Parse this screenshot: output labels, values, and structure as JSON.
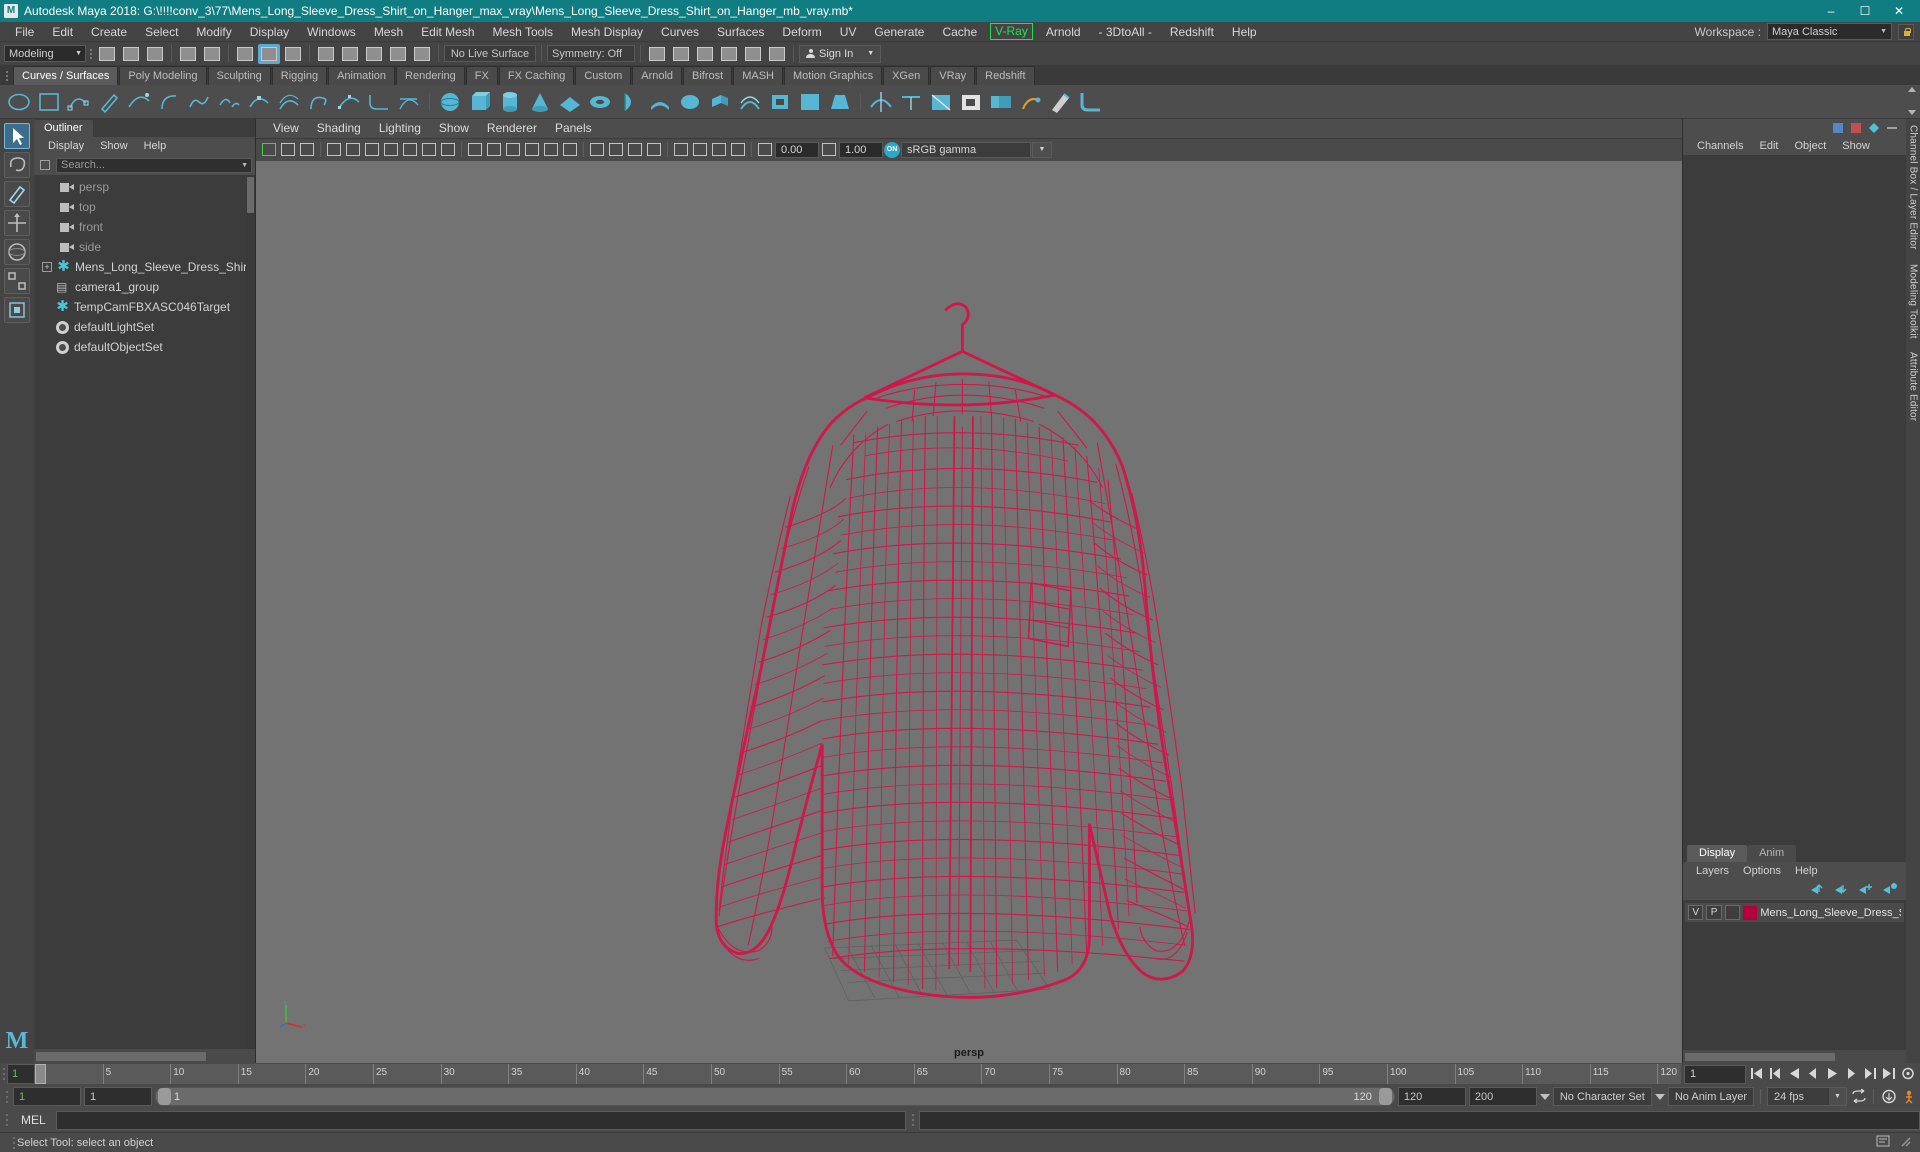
{
  "window": {
    "title": "Autodesk Maya 2018: G:\\!!!!conv_3\\77\\Mens_Long_Sleeve_Dress_Shirt_on_Hanger_max_vray\\Mens_Long_Sleeve_Dress_Shirt_on_Hanger_mb_vray.mb*",
    "app_icon": "M",
    "minimize": "–",
    "maximize": "☐",
    "close": "✕"
  },
  "menubar": {
    "items": [
      "File",
      "Edit",
      "Create",
      "Select",
      "Modify",
      "Display",
      "Windows",
      "Mesh",
      "Edit Mesh",
      "Mesh Tools",
      "Mesh Display",
      "Curves",
      "Surfaces",
      "Deform",
      "UV",
      "Generate",
      "Cache",
      "V-Ray",
      "Arnold",
      "- 3DtoAll -",
      "Redshift",
      "Help"
    ],
    "highlight_item": "V-Ray",
    "highlight_color": "#22e04a",
    "workspace_label": "Workspace :",
    "workspace_value": "Maya Classic"
  },
  "statusline": {
    "mode": "Modeling",
    "live_surface": "No Live Surface",
    "symmetry": "Symmetry: Off",
    "signin": "Sign In"
  },
  "shelf": {
    "tabs": [
      "Curves / Surfaces",
      "Poly Modeling",
      "Sculpting",
      "Rigging",
      "Animation",
      "Rendering",
      "FX",
      "FX Caching",
      "Custom",
      "Arnold",
      "Bifrost",
      "MASH",
      "Motion Graphics",
      "XGen",
      "VRay",
      "Redshift"
    ],
    "active_tab": "Curves / Surfaces"
  },
  "outliner": {
    "tab": "Outliner",
    "menus": [
      "Display",
      "Show",
      "Help"
    ],
    "search_placeholder": "Search...",
    "items": [
      {
        "label": "persp",
        "icon": "camera-icon",
        "dim": true
      },
      {
        "label": "top",
        "icon": "camera-icon",
        "dim": true
      },
      {
        "label": "front",
        "icon": "camera-icon",
        "dim": true
      },
      {
        "label": "side",
        "icon": "camera-icon",
        "dim": true
      },
      {
        "label": "Mens_Long_Sleeve_Dress_Shirt_on_H",
        "icon": "transform-icon",
        "expandable": true
      },
      {
        "label": "camera1_group",
        "icon": "group-icon"
      },
      {
        "label": "TempCamFBXASC046Target",
        "icon": "transform-icon"
      },
      {
        "label": "defaultLightSet",
        "icon": "set-icon"
      },
      {
        "label": "defaultObjectSet",
        "icon": "set-icon"
      }
    ]
  },
  "viewport": {
    "menus": [
      "View",
      "Shading",
      "Lighting",
      "Show",
      "Renderer",
      "Panels"
    ],
    "exposure": "0.00",
    "gamma_value": "1.00",
    "color_management": "sRGB gamma",
    "camera_label": "persp",
    "wireframe_color": "#d4144a",
    "background_color": "#737373"
  },
  "rightpanel": {
    "channelbox_menus": [
      "Channels",
      "Edit",
      "Object",
      "Show"
    ],
    "layer_tabs": [
      "Display",
      "Anim"
    ],
    "layer_active_tab": "Display",
    "layer_menus": [
      "Layers",
      "Options",
      "Help"
    ],
    "layers": [
      {
        "v": "V",
        "p": "P",
        "color": "#b3003c",
        "name": "Mens_Long_Sleeve_Dress_Shir"
      }
    ],
    "vertical_tabs": [
      "Channel Box / Layer Editor",
      "Modeling Toolkit",
      "Attribute Editor"
    ]
  },
  "timeline": {
    "current_frame_left": "1",
    "ticks": [
      "5",
      "10",
      "15",
      "20",
      "25",
      "30",
      "35",
      "40",
      "45",
      "50",
      "55",
      "60",
      "65",
      "70",
      "75",
      "80",
      "85",
      "90",
      "95",
      "100",
      "105",
      "110",
      "115",
      "120"
    ],
    "playback_frame": "1"
  },
  "rangeslider": {
    "start": "1",
    "anim_start": "1",
    "range_start_label": "1",
    "range_end_label": "120",
    "anim_end": "120",
    "end": "200",
    "character_set": "No Character Set",
    "anim_layer": "No Anim Layer",
    "fps": "24 fps"
  },
  "command": {
    "label": "MEL",
    "input_value": ""
  },
  "statusbar": {
    "message": "Select Tool: select an object"
  }
}
